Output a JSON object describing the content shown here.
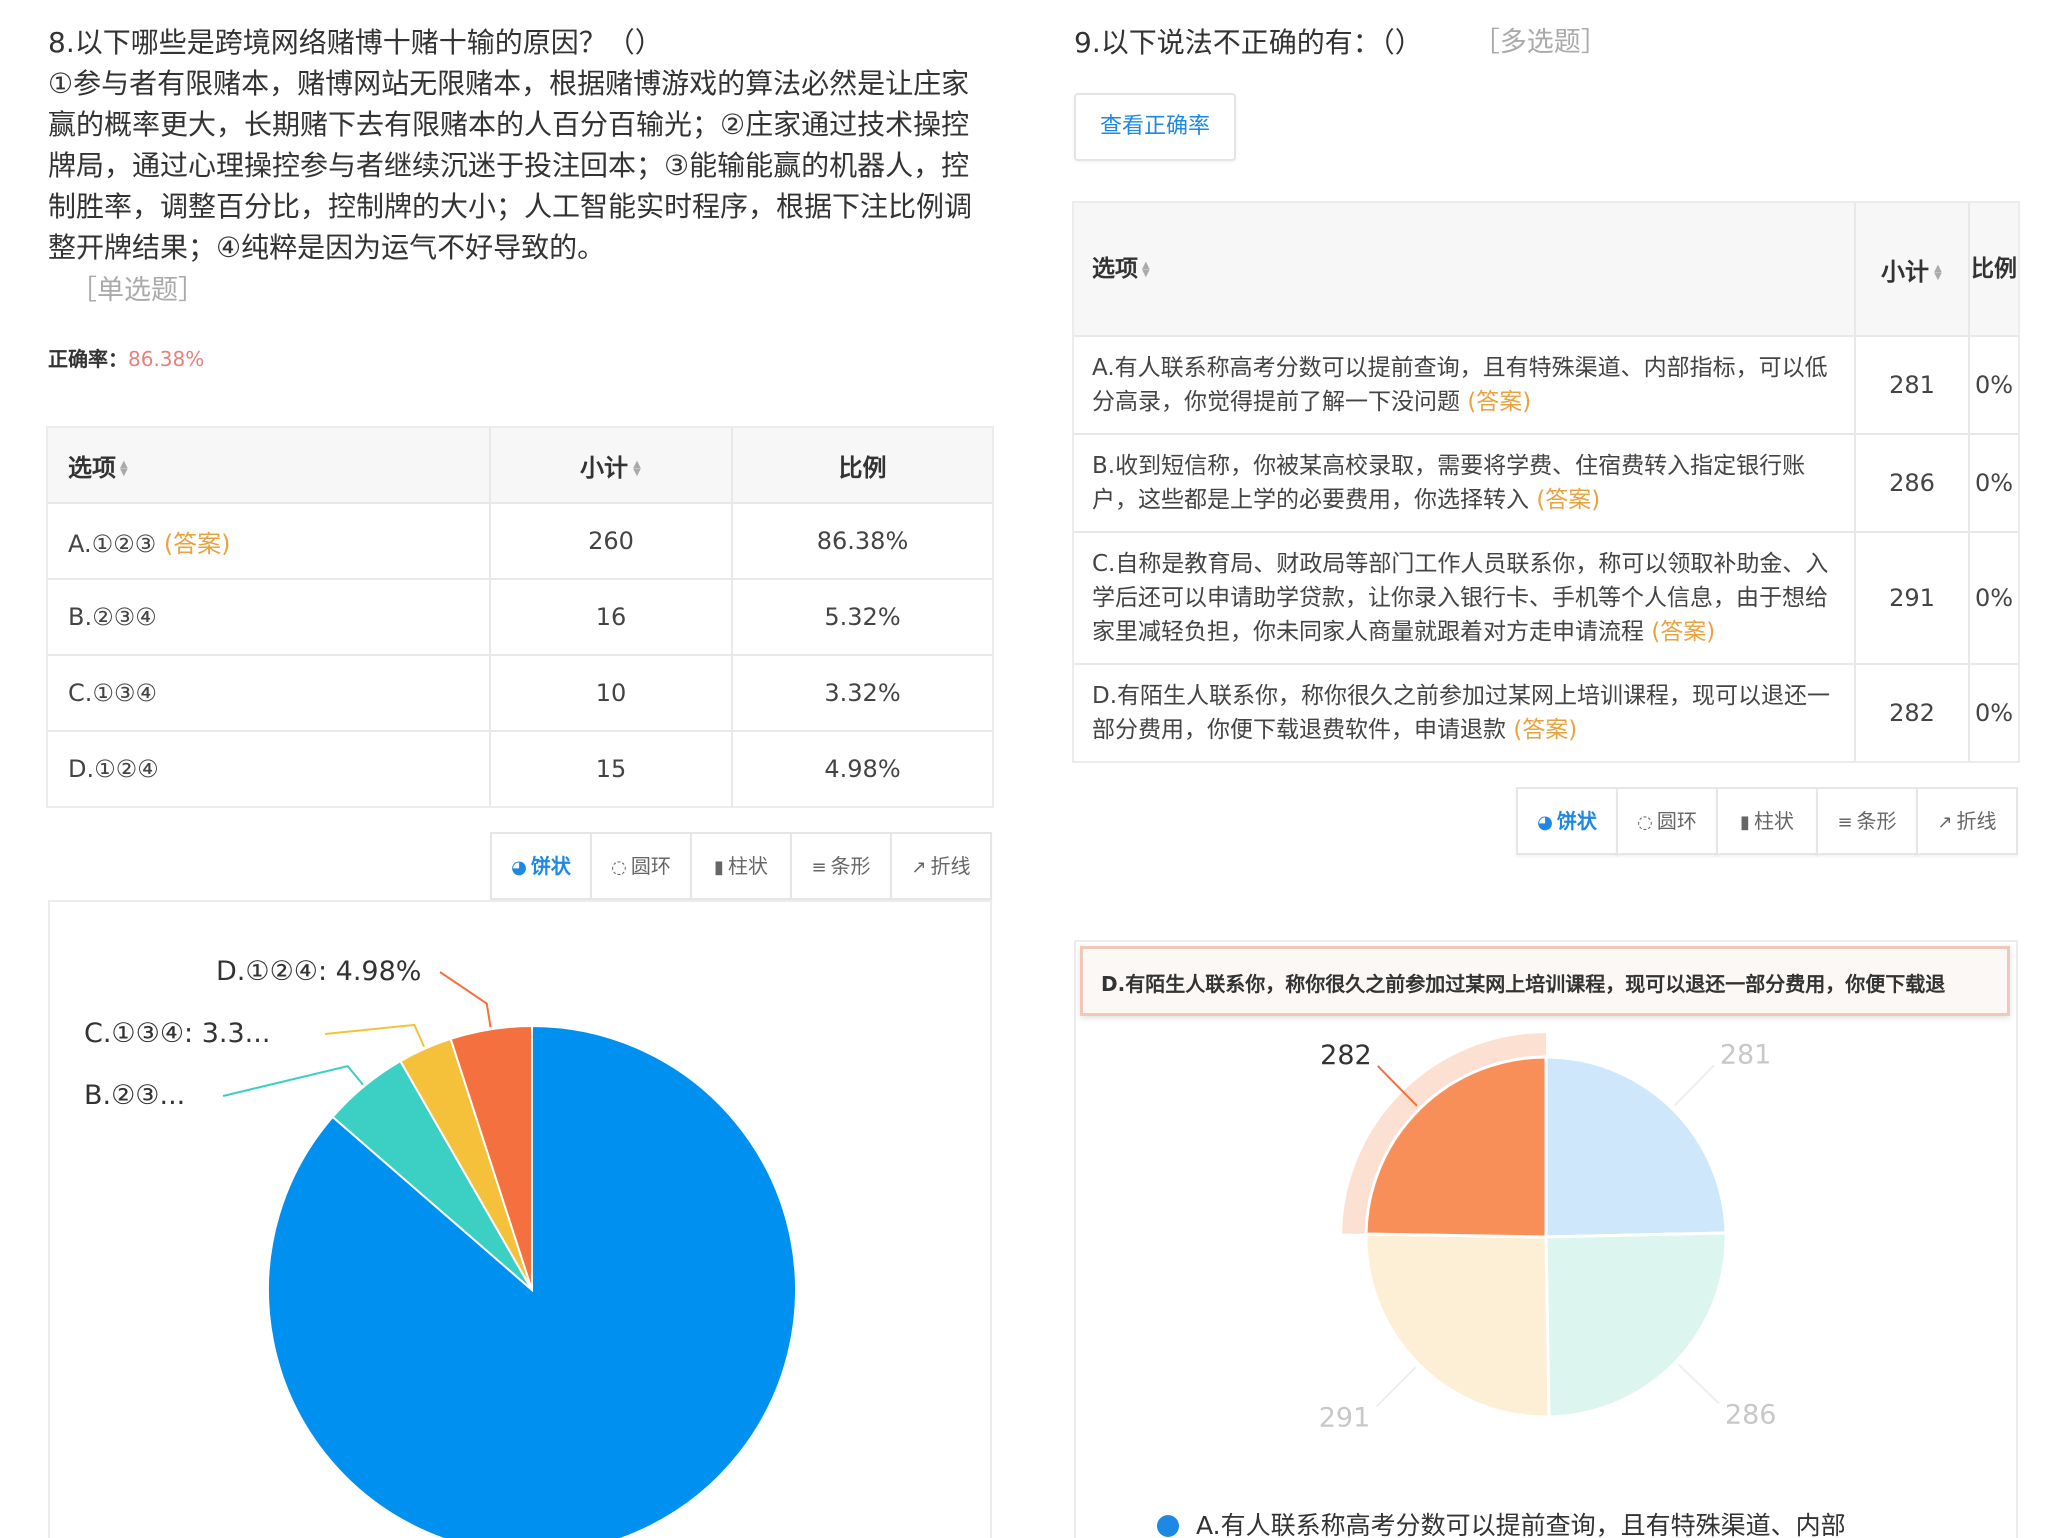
{
  "q8": {
    "title": "8.以下哪些是跨境网络赌博十赌十输的原因？（）",
    "body": "①参与者有限赌本，赌博网站无限赌本，根据赌博游戏的算法必然是让庄家赢的概率更大，长期赌下去有限赌本的人百分百输光；②庄家通过技术操控牌局，通过心理操控参与者继续沉迷于投注回本；③能输能赢的机器人，控制胜率，调整百分比，控制牌的大小；人工智能实时程序，根据下注比例调整开牌结果；④纯粹是因为运气不好导致的。",
    "type": "［单选题］",
    "accuracy_label": "正确率：",
    "accuracy_value": "86.38%",
    "columns": [
      "选项",
      "小计",
      "比例"
    ],
    "rows": [
      {
        "option": "A.①②③",
        "answer": "(答案)",
        "count": "260",
        "percent": "86.38%"
      },
      {
        "option": "B.②③④",
        "answer": "",
        "count": "16",
        "percent": "5.32%"
      },
      {
        "option": "C.①③④",
        "answer": "",
        "count": "10",
        "percent": "3.32%"
      },
      {
        "option": "D.①②④",
        "answer": "",
        "count": "15",
        "percent": "4.98%"
      }
    ],
    "tabs": [
      "饼状",
      "圆环",
      "柱状",
      "条形",
      "折线"
    ]
  },
  "q9": {
    "title": "9.以下说法不正确的有：（）",
    "type": "［多选题］",
    "view_button": "查看正确率",
    "columns": [
      "选项",
      "小计",
      "比例"
    ],
    "rows": [
      {
        "option": "A.有人联系称高考分数可以提前查询，且有特殊渠道、内部指标，可以低分高录，你觉得提前了解一下没问题",
        "answer": "(答案)",
        "count": "281",
        "percent": "0%"
      },
      {
        "option": "B.收到短信称，你被某高校录取，需要将学费、住宿费转入指定银行账户，这些都是上学的必要费用，你选择转入",
        "answer": "(答案)",
        "count": "286",
        "percent": "0%"
      },
      {
        "option": "C.自称是教育局、财政局等部门工作人员联系你，称可以领取补助金、入学后还可以申请助学贷款，让你录入银行卡、手机等个人信息，由于想给家里减轻负担，你未同家人商量就跟着对方走申请流程",
        "answer": "(答案)",
        "count": "291",
        "percent": "0%"
      },
      {
        "option": "D.有陌生人联系你，称你很久之前参加过某网上培训课程，现可以退还一部分费用，你便下载退费软件，申请退款",
        "answer": "(答案)",
        "count": "282",
        "percent": "0%"
      }
    ],
    "tabs": [
      "饼状",
      "圆环",
      "柱状",
      "条形",
      "折线"
    ],
    "tooltip": "D.有陌生人联系你，称你很久之前参加过某网上培训课程，现可以退还一部分费用，你便下载退",
    "legend_first": "A.有人联系称高考分数可以提前查询，且有特殊渠道、内部"
  },
  "chart_data": [
    {
      "type": "pie",
      "categories": [
        "A.①②③",
        "B.②③④",
        "C.①③④",
        "D.①②④"
      ],
      "values": [
        260,
        16,
        10,
        15
      ],
      "slice_labels": [
        "",
        "B.②③...",
        "C.①③④: 3.3...",
        "D.①②④: 4.98%"
      ],
      "colors": [
        "#0090f0",
        "#3ccfc4",
        "#f5c13a",
        "#f4703e"
      ]
    },
    {
      "type": "pie",
      "categories": [
        "A",
        "B",
        "C",
        "D"
      ],
      "values": [
        281,
        286,
        291,
        282
      ],
      "slice_labels": [
        "281",
        "286",
        "291",
        "282"
      ],
      "highlighted": "D",
      "colors": [
        "#cfe7fb",
        "#dcf5ee",
        "#fdefd6",
        "#f88e58"
      ]
    }
  ]
}
